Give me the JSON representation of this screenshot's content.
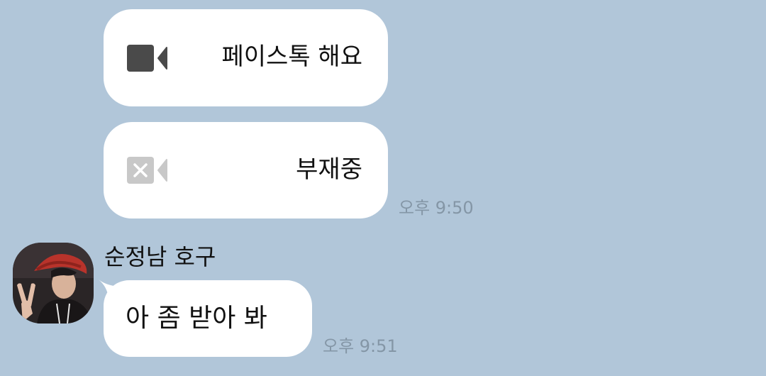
{
  "messages": [
    {
      "type": "call",
      "icon": "video-camera-icon",
      "text": "페이스톡 해요"
    },
    {
      "type": "call",
      "icon": "missed-video-call-icon",
      "text": "부재중",
      "time": "오후 9:50"
    },
    {
      "type": "text",
      "sender": "순정남 호구",
      "avatar": "profile-avatar",
      "text": "아 좀 받아 봐",
      "time": "오후 9:51"
    }
  ],
  "colors": {
    "background": "#b1c6d9",
    "bubble": "#ffffff",
    "timestamp": "#8496a6",
    "icon_dark": "#4a4a4a",
    "icon_light": "#c8c8c8"
  }
}
